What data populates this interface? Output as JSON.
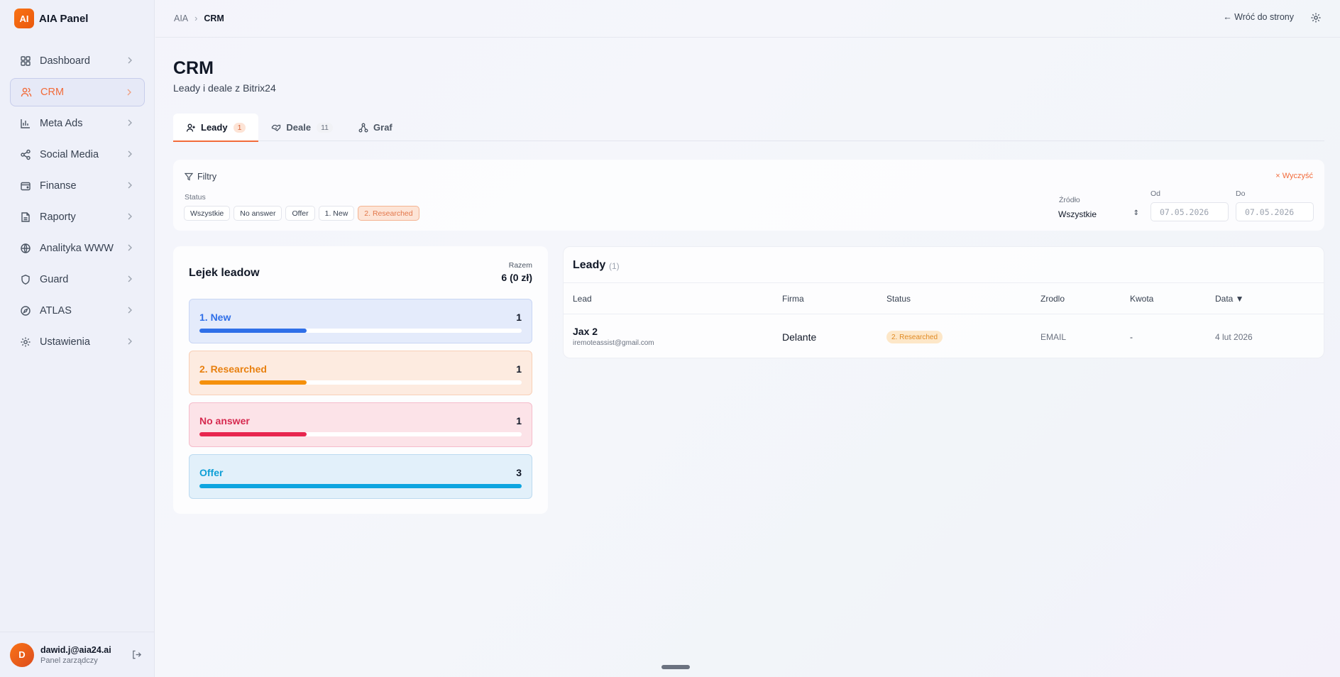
{
  "brand": {
    "logo": "AI",
    "name": "AIA Panel"
  },
  "sidebar": {
    "items": [
      {
        "label": "Dashboard",
        "icon": "dashboard-icon"
      },
      {
        "label": "CRM",
        "icon": "users-icon",
        "active": true
      },
      {
        "label": "Meta Ads",
        "icon": "bar-chart-icon"
      },
      {
        "label": "Social Media",
        "icon": "share-icon"
      },
      {
        "label": "Finanse",
        "icon": "wallet-icon"
      },
      {
        "label": "Raporty",
        "icon": "report-icon"
      },
      {
        "label": "Analityka WWW",
        "icon": "globe-icon"
      },
      {
        "label": "Guard",
        "icon": "shield-icon"
      },
      {
        "label": "ATLAS",
        "icon": "compass-icon"
      },
      {
        "label": "Ustawienia",
        "icon": "gear-icon"
      }
    ]
  },
  "user": {
    "initial": "D",
    "email": "dawid.j@aia24.ai",
    "role": "Panel zarządczy"
  },
  "topbar": {
    "crumb_root": "AIA",
    "crumb_current": "CRM",
    "back_label": "← Wróć do strony"
  },
  "header": {
    "title": "CRM",
    "subtitle": "Leady i deale z Bitrix24"
  },
  "tabs": [
    {
      "label": "Leady",
      "count": "1",
      "active": true
    },
    {
      "label": "Deale",
      "count": "11"
    },
    {
      "label": "Graf"
    }
  ],
  "filters": {
    "title": "Filtry",
    "clear_label": "× Wyczyść",
    "status_label": "Status",
    "chips": [
      "Wszystkie",
      "No answer",
      "Offer",
      "1. New",
      "2. Researched"
    ],
    "active_chip": "2. Researched",
    "source_label": "Źródło",
    "source_value": "Wszystkie",
    "from_label": "Od",
    "from_value": "07.05.2026",
    "to_label": "Do",
    "to_value": "07.05.2026"
  },
  "funnel": {
    "title": "Lejek leadow",
    "total_label": "Razem",
    "total_value": "6 (0 zł)",
    "stages": [
      {
        "label": "1. New",
        "count": "1",
        "fraction": 0.333,
        "color": "#2f6fe8",
        "bg": "#e4ebfb",
        "border": "#c9d6f4",
        "text": "#2f6fe8"
      },
      {
        "label": "2. Researched",
        "count": "1",
        "fraction": 0.333,
        "color": "#f5900b",
        "bg": "#fdebe0",
        "border": "#f8cfb6",
        "text": "#e8800f"
      },
      {
        "label": "No answer",
        "count": "1",
        "fraction": 0.333,
        "color": "#e8264f",
        "bg": "#fce3e8",
        "border": "#f5bccb",
        "text": "#d62a4f"
      },
      {
        "label": "Offer",
        "count": "3",
        "fraction": 1.0,
        "color": "#0ea5e0",
        "bg": "#e2f0fa",
        "border": "#bcdaf0",
        "text": "#0f9fd6"
      }
    ]
  },
  "leads": {
    "title": "Leady",
    "count": "(1)",
    "columns": [
      "Lead",
      "Firma",
      "Status",
      "Zrodlo",
      "Kwota",
      "Data ▼"
    ],
    "rows": [
      {
        "name": "Jax 2",
        "email": "iremoteassist@gmail.com",
        "company": "Delante",
        "status": "2. Researched",
        "source": "EMAIL",
        "amount": "-",
        "date": "4 lut 2026"
      }
    ]
  }
}
